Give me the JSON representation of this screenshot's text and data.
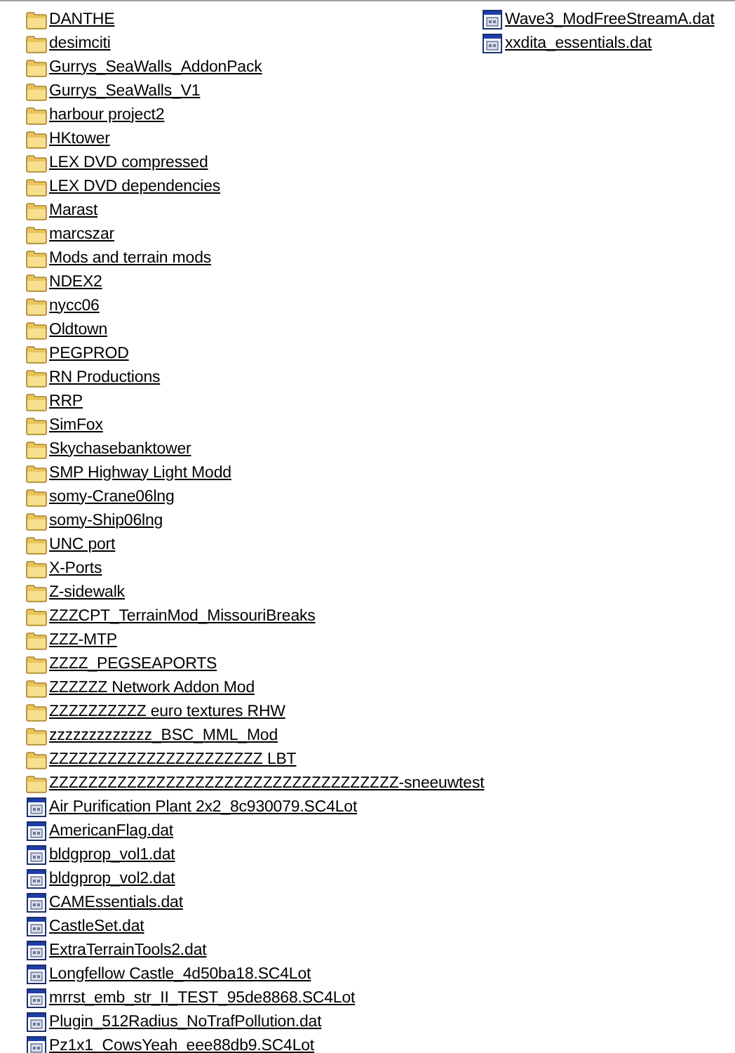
{
  "columns": [
    {
      "items": [
        {
          "kind": "folder",
          "name": "DANTHE"
        },
        {
          "kind": "folder",
          "name": "desimciti"
        },
        {
          "kind": "folder",
          "name": "Gurrys_SeaWalls_AddonPack"
        },
        {
          "kind": "folder",
          "name": "Gurrys_SeaWalls_V1"
        },
        {
          "kind": "folder",
          "name": "harbour project2"
        },
        {
          "kind": "folder",
          "name": "HKtower"
        },
        {
          "kind": "folder",
          "name": "LEX DVD compressed"
        },
        {
          "kind": "folder",
          "name": "LEX DVD dependencies"
        },
        {
          "kind": "folder",
          "name": "Marast"
        },
        {
          "kind": "folder",
          "name": "marcszar"
        },
        {
          "kind": "folder",
          "name": "Mods and terrain mods"
        },
        {
          "kind": "folder",
          "name": "NDEX2"
        },
        {
          "kind": "folder",
          "name": "nycc06"
        },
        {
          "kind": "folder",
          "name": "Oldtown"
        },
        {
          "kind": "folder",
          "name": "PEGPROD"
        },
        {
          "kind": "folder",
          "name": "RN Productions"
        },
        {
          "kind": "folder",
          "name": "RRP"
        },
        {
          "kind": "folder",
          "name": "SimFox"
        },
        {
          "kind": "folder",
          "name": "Skychasebanktower"
        },
        {
          "kind": "folder",
          "name": "SMP Highway Light Modd"
        },
        {
          "kind": "folder",
          "name": "somy-Crane06lng"
        },
        {
          "kind": "folder",
          "name": "somy-Ship06lng"
        },
        {
          "kind": "folder",
          "name": "UNC port"
        },
        {
          "kind": "folder",
          "name": "X-Ports"
        },
        {
          "kind": "folder",
          "name": "Z-sidewalk"
        },
        {
          "kind": "folder",
          "name": "ZZZCPT_TerrainMod_MissouriBreaks"
        },
        {
          "kind": "folder",
          "name": "ZZZ-MTP"
        },
        {
          "kind": "folder",
          "name": "ZZZZ_PEGSEAPORTS"
        },
        {
          "kind": "folder",
          "name": "ZZZZZZ Network Addon Mod"
        },
        {
          "kind": "folder",
          "name": "ZZZZZZZZZZ euro textures RHW"
        },
        {
          "kind": "folder",
          "name": "zzzzzzzzzzzzz_BSC_MML_Mod"
        },
        {
          "kind": "folder",
          "name": "ZZZZZZZZZZZZZZZZZZZZZZ LBT"
        },
        {
          "kind": "folder",
          "name": "ZZZZZZZZZZZZZZZZZZZZZZZZZZZZZZZZZZZZ-sneeuwtest"
        },
        {
          "kind": "file",
          "name": "Air Purification Plant 2x2_8c930079.SC4Lot"
        },
        {
          "kind": "file",
          "name": "AmericanFlag.dat"
        },
        {
          "kind": "file",
          "name": "bldgprop_vol1.dat"
        },
        {
          "kind": "file",
          "name": "bldgprop_vol2.dat"
        },
        {
          "kind": "file",
          "name": "CAMEssentials.dat"
        },
        {
          "kind": "file",
          "name": "CastleSet.dat"
        },
        {
          "kind": "file",
          "name": "ExtraTerrainTools2.dat"
        },
        {
          "kind": "file",
          "name": "Longfellow Castle_4d50ba18.SC4Lot"
        },
        {
          "kind": "file",
          "name": "mrrst_emb_str_II_TEST_95de8868.SC4Lot"
        },
        {
          "kind": "file",
          "name": "Plugin_512Radius_NoTrafPollution.dat"
        },
        {
          "kind": "file",
          "name": "Pz1x1_CowsYeah_eee88db9.SC4Lot"
        }
      ]
    },
    {
      "items": [
        {
          "kind": "file",
          "name": "Wave3_ModFreeStreamA.dat"
        },
        {
          "kind": "file",
          "name": "xxdita_essentials.dat"
        }
      ]
    }
  ]
}
